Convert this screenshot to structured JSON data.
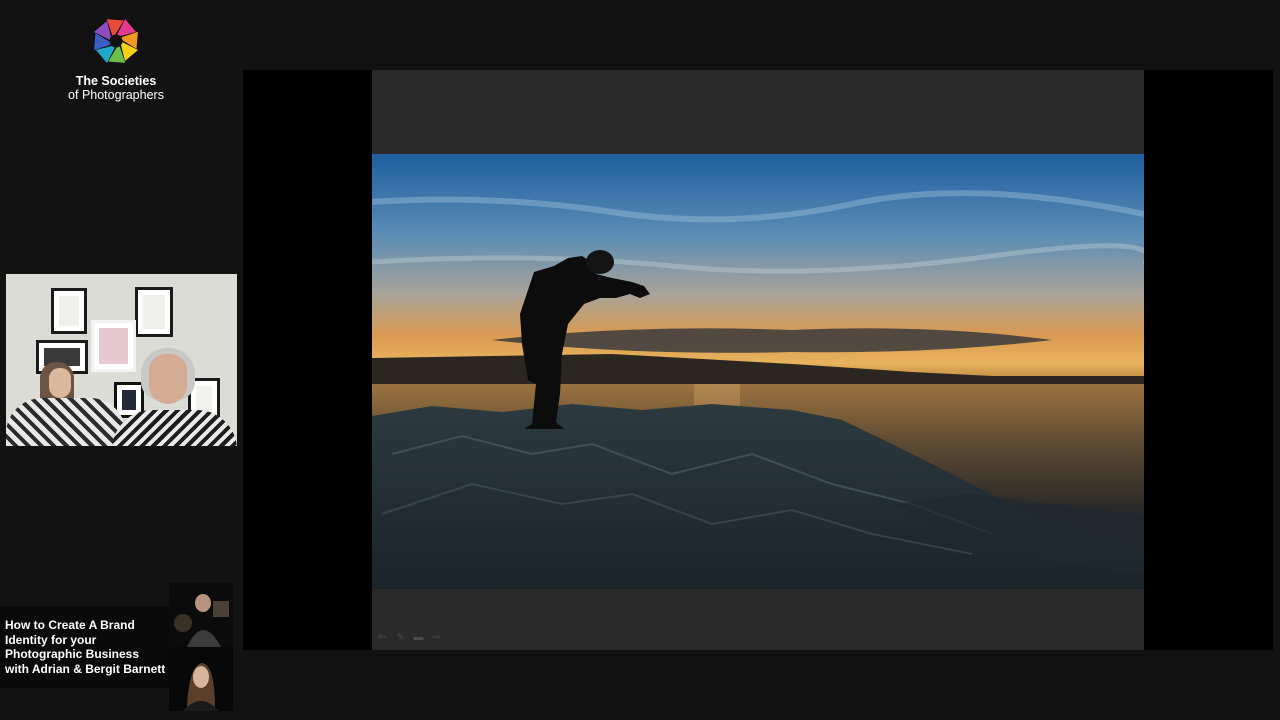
{
  "brand": {
    "name_line1": "The Societies",
    "name_line2": "of Photographers",
    "logo_colors": [
      "#e63a8c",
      "#f39a1e",
      "#f5d313",
      "#6cbf4a",
      "#20a9c9",
      "#3a5fc7",
      "#8e4cc4",
      "#e94a3a"
    ]
  },
  "presenter_video": {
    "icon": "webcam-feed"
  },
  "session": {
    "title_lines": [
      "How to Create A Brand",
      "Identity for your",
      "Photographic Business",
      "with Adrian & Bergit Barnett"
    ]
  },
  "slide": {
    "image": "silhouette-sunset-rocks-photo",
    "toolbar": [
      {
        "icon": "back-arrow-icon",
        "glyph": "⇦"
      },
      {
        "icon": "pencil-icon",
        "glyph": "✎"
      },
      {
        "icon": "slides-icon",
        "glyph": "▬"
      },
      {
        "icon": "forward-arrow-icon",
        "glyph": "⇨"
      }
    ]
  },
  "colors": {
    "background": "#121212",
    "stage": "#000000",
    "slide": "#2a2a2a"
  }
}
